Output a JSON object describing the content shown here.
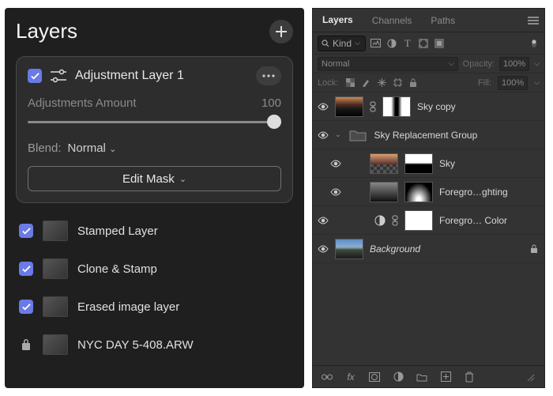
{
  "left": {
    "title": "Layers",
    "card": {
      "layer_name": "Adjustment Layer 1",
      "amount_label": "Adjustments Amount",
      "amount_value": "100",
      "blend_label": "Blend:",
      "blend_mode": "Normal",
      "edit_mask": "Edit Mask"
    },
    "list": [
      {
        "name": "Stamped Layer",
        "locked": false
      },
      {
        "name": "Clone & Stamp",
        "locked": false
      },
      {
        "name": "Erased image layer",
        "locked": false
      },
      {
        "name": "NYC DAY 5-408.ARW",
        "locked": true
      }
    ]
  },
  "right": {
    "tabs": {
      "layers": "Layers",
      "channels": "Channels",
      "paths": "Paths"
    },
    "filter_label": "Kind",
    "blend_mode": "Normal",
    "opacity_label": "Opacity:",
    "opacity_value": "100%",
    "lock_label": "Lock:",
    "fill_label": "Fill:",
    "fill_value": "100%",
    "layers": {
      "sky_copy": "Sky copy",
      "group": "Sky Replacement Group",
      "sky": "Sky",
      "fore_light": "Foregro…ghting",
      "fore_color": "Foregro… Color",
      "background": "Background"
    }
  }
}
